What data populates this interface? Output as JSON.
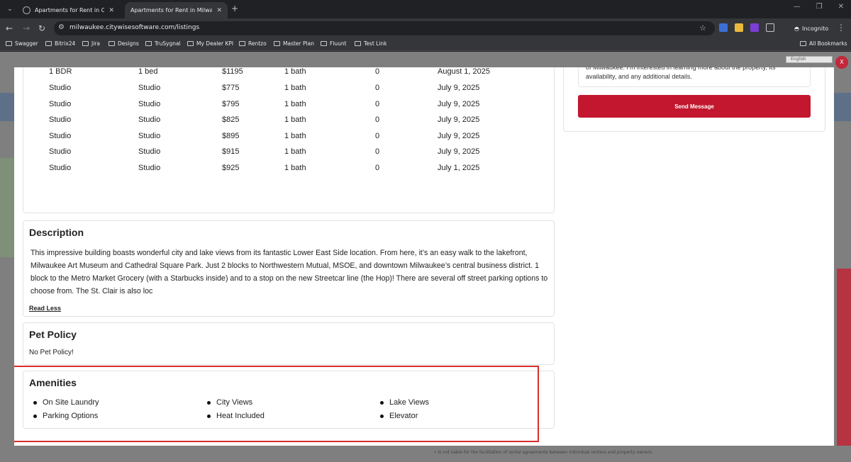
{
  "browser": {
    "tabs": [
      {
        "title": "Apartments for Rent in Official"
      },
      {
        "title": "Apartments for Rent in Milwauk"
      }
    ],
    "url": "milwaukee.citywisesoftware.com/listings",
    "incognito_label": "Incognito",
    "bookmarks": [
      "Swagger",
      "Bitrix24",
      "Jira",
      "Designs",
      "TruSygnal",
      "My Dealer KPI",
      "Rentzo",
      "Master Plan",
      "Fluunt",
      "Test Link"
    ],
    "all_bookmarks": "All Bookmarks"
  },
  "background": {
    "language": "English",
    "close_label": "X",
    "footer_note": "is not liable for the facilitation of rental agreements between individual renters and property owners."
  },
  "units_table": {
    "rows": [
      {
        "type": "1 BDR",
        "beds": "1 bed",
        "price": "$1195",
        "baths": "1 bath",
        "deposit": "0",
        "available": "August 1, 2025"
      },
      {
        "type": "Studio",
        "beds": "Studio",
        "price": "$775",
        "baths": "1 bath",
        "deposit": "0",
        "available": "July 9, 2025"
      },
      {
        "type": "Studio",
        "beds": "Studio",
        "price": "$795",
        "baths": "1 bath",
        "deposit": "0",
        "available": "July 9, 2025"
      },
      {
        "type": "Studio",
        "beds": "Studio",
        "price": "$825",
        "baths": "1 bath",
        "deposit": "0",
        "available": "July 9, 2025"
      },
      {
        "type": "Studio",
        "beds": "Studio",
        "price": "$895",
        "baths": "1 bath",
        "deposit": "0",
        "available": "July 9, 2025"
      },
      {
        "type": "Studio",
        "beds": "Studio",
        "price": "$915",
        "baths": "1 bath",
        "deposit": "0",
        "available": "July 9, 2025"
      },
      {
        "type": "Studio",
        "beds": "Studio",
        "price": "$925",
        "baths": "1 bath",
        "deposit": "0",
        "available": "July 1, 2025"
      }
    ]
  },
  "description": {
    "title": "Description",
    "text": "This impressive building boasts wonderful city and lake views from its fantastic Lower East Side location. From here, it’s an easy walk to the lakefront, Milwaukee Art Museum and Cathedral Square Park. Just 2 blocks to Northwestern Mutual, MSOE, and downtown Milwaukee’s central business district. 1 block to the Metro Market Grocery (with a Starbucks inside) and to a stop on the new Streetcar line (the Hop)! There are several off street parking options to choose from. The St. Clair is also loc",
    "read_less": "Read Less"
  },
  "pet_policy": {
    "title": "Pet Policy",
    "text": "No Pet Policy!"
  },
  "amenities": {
    "title": "Amenities",
    "items": [
      "On Site Laundry",
      "Parking Options",
      "City Views",
      "Heat Included",
      "Lake Views",
      "Elevator"
    ]
  },
  "contact": {
    "message": "of Milwaukee. I’m interested in learning more about the property, its availability, and any additional details.",
    "send_label": "Send Message"
  },
  "colors": {
    "accent": "#c2172e",
    "highlight": "#d92d2d"
  }
}
